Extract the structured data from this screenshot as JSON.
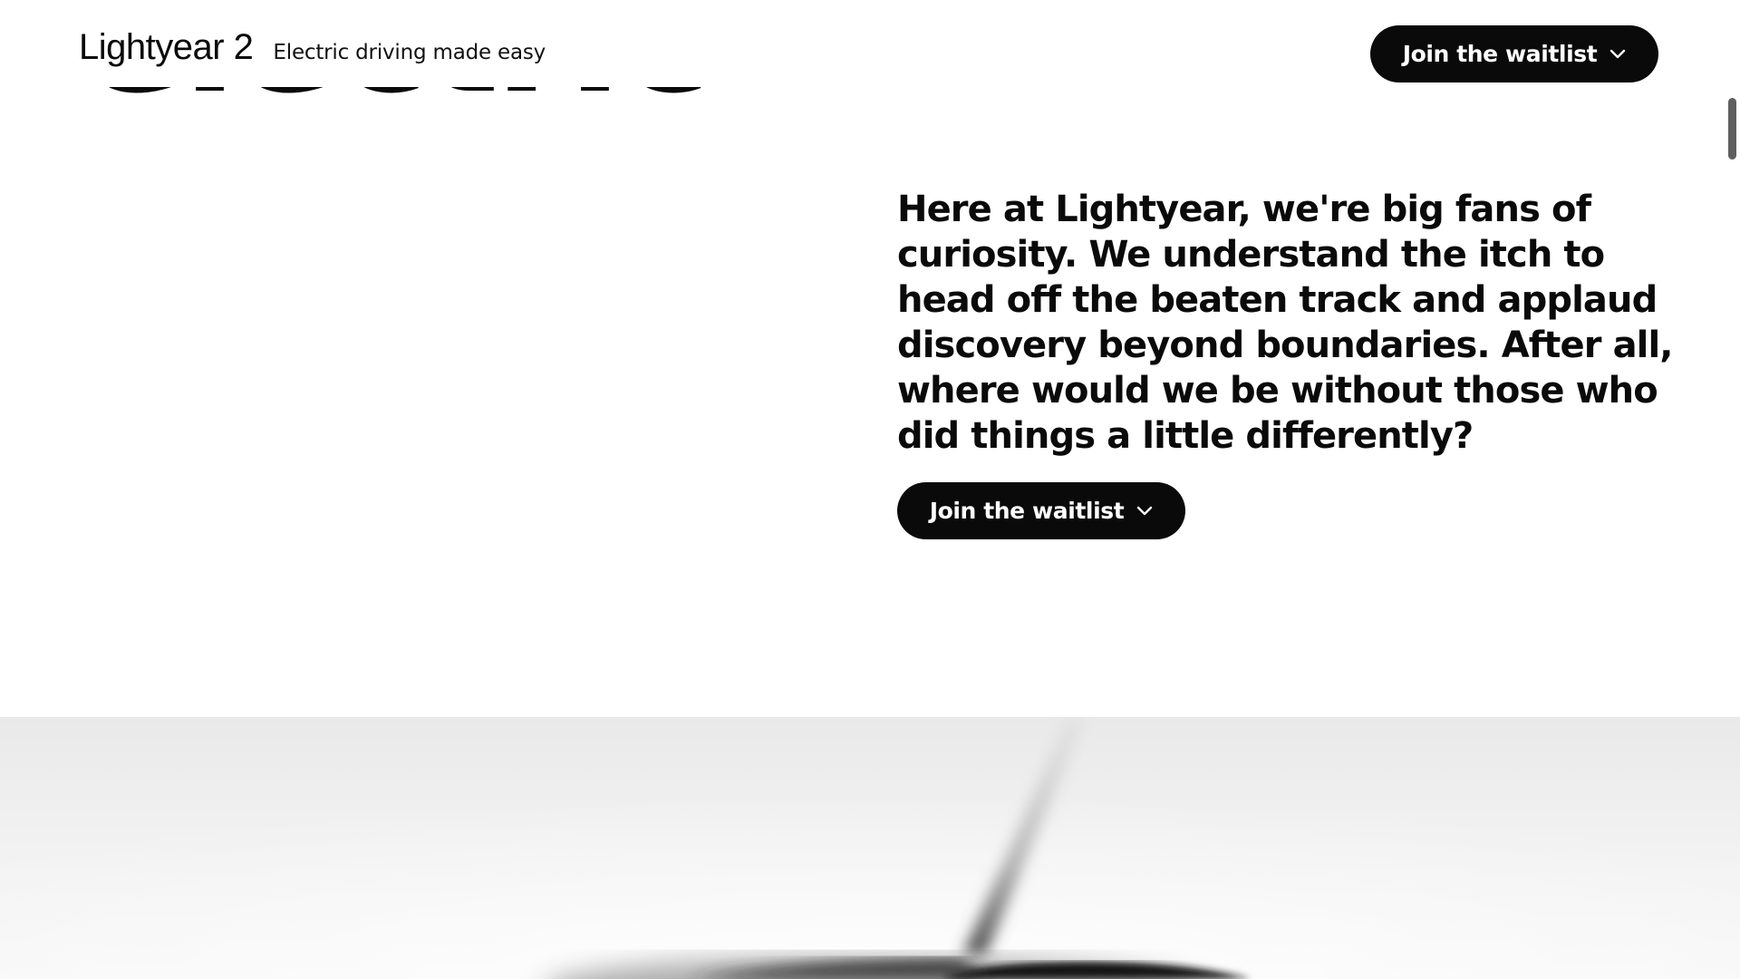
{
  "header": {
    "logo": "Lightyear 2",
    "tagline": "Electric driving made easy",
    "cta_label": "Join the waitlist",
    "cta_icon": "chevron-down-icon"
  },
  "hero": {
    "heading_fragment": "electric"
  },
  "intro": {
    "text": "Here at Lightyear, we're big fans of curiosity. We understand the itch to head off the beaten track and applaud discovery beyond boundaries. After all, where would we be without those who did things a little differently?",
    "cta_label": "Join the waitlist",
    "cta_icon": "chevron-down-icon"
  },
  "colors": {
    "background": "#ffffff",
    "text": "#0a0a0a",
    "button_bg": "#0a0a0a",
    "button_text": "#ffffff",
    "image_band": "#ececec"
  }
}
